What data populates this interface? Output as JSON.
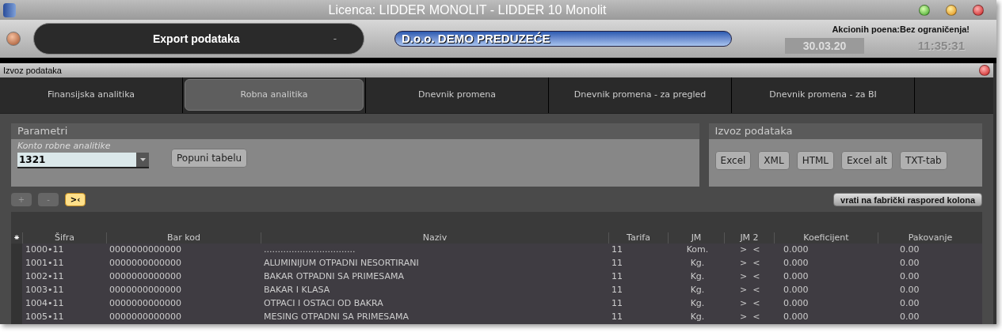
{
  "window": {
    "title": "Licenca: LIDDER MONOLIT - LIDDER 10 Monolit"
  },
  "header": {
    "module": "Export podataka",
    "module_hint": "-",
    "company": "D.o.o. DEMO PREDUZEĆE",
    "notice": "Akcionih poena:Bez ograničenja!",
    "date": "30.03.20",
    "time": "11:35:31"
  },
  "subwindow": {
    "title": "Izvoz podataka"
  },
  "tabs": [
    {
      "label": "Finansijska analitika",
      "selected": false
    },
    {
      "label": "Robna analitika",
      "selected": true
    },
    {
      "label": "Dnevnik promena",
      "selected": false
    },
    {
      "label": "Dnevnik promena - za pregled",
      "selected": false
    },
    {
      "label": "Dnevnik promena - za BI",
      "selected": false
    }
  ],
  "parameters": {
    "title": "Parametri",
    "field_label": "Konto robne analitike",
    "field_value": "1321",
    "fill_button": "Popuni tabelu"
  },
  "export": {
    "title": "Izvoz podataka",
    "buttons": [
      "Excel",
      "XML",
      "HTML",
      "Excel alt",
      "TXT-tab"
    ]
  },
  "toolbar": {
    "buttons": [
      {
        "label": "+",
        "selected": false
      },
      {
        "label": "-",
        "selected": false
      },
      {
        "label": ">‹",
        "selected": true
      }
    ],
    "reset": "vrati na fabrički raspored kolona"
  },
  "table": {
    "marker": "⁕",
    "columns": [
      "Šifra",
      "Bar kod",
      "Naziv",
      "Tarifa",
      "JM",
      "JM 2",
      "Koeficijent",
      "Pakovanje"
    ],
    "rows": [
      [
        "1000•11",
        "0000000000000",
        ".................................",
        "11",
        "Kom.",
        ">  <",
        "0.000",
        "0.00"
      ],
      [
        "1001•11",
        "0000000000000",
        "ALUMINIJUM OTPADNI NESORTIRANI",
        "11",
        "Kg.",
        ">  <",
        "0.000",
        "0.00"
      ],
      [
        "1002•11",
        "0000000000000",
        "BAKAR OTPADNI SA PRIMESAMA",
        "11",
        "Kg.",
        ">  <",
        "0.000",
        "0.00"
      ],
      [
        "1003•11",
        "0000000000000",
        "BAKAR I KLASA",
        "11",
        "Kg.",
        ">  <",
        "0.000",
        "0.00"
      ],
      [
        "1004•11",
        "0000000000000",
        "OTPACI I OSTACI OD BAKRA",
        "11",
        "Kg.",
        ">  <",
        "0.000",
        "0.00"
      ],
      [
        "1005•11",
        "0000000000000",
        "MESING OTPADNI SA PRIMESAMA",
        "11",
        "Kg.",
        ">  <",
        "0.000",
        "0.00"
      ]
    ]
  }
}
